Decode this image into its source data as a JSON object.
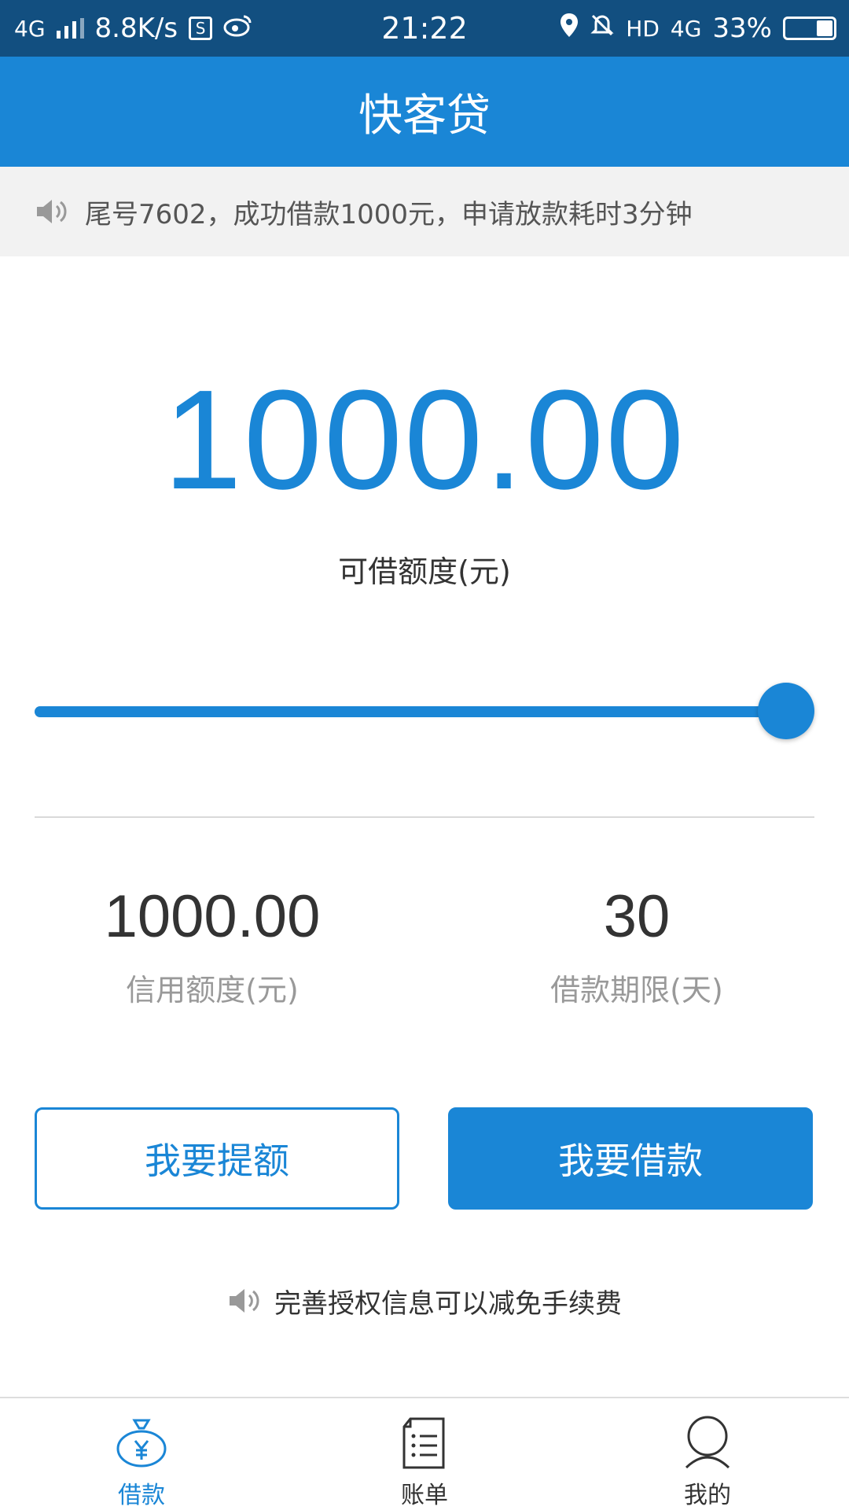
{
  "status_bar": {
    "network": "4G",
    "speed": "8.8K/s",
    "time": "21:22",
    "hd": "HD",
    "network2": "4G",
    "battery": "33%"
  },
  "header": {
    "title": "快客贷"
  },
  "notice": {
    "text": "尾号7602，成功借款1000元，申请放款耗时3分钟"
  },
  "loan": {
    "available_amount": "1000.00",
    "available_label": "可借额度(元)",
    "slider_fraction": 1.0
  },
  "stats": {
    "credit_value": "1000.00",
    "credit_label": "信用额度(元)",
    "term_value": "30",
    "term_label": "借款期限(天)"
  },
  "buttons": {
    "increase_label": "我要提额",
    "borrow_label": "我要借款"
  },
  "tip": {
    "text": "完善授权信息可以减免手续费"
  },
  "nav": {
    "items": [
      {
        "label": "借款",
        "icon": "money-bag-icon",
        "active": true
      },
      {
        "label": "账单",
        "icon": "bill-icon",
        "active": false
      },
      {
        "label": "我的",
        "icon": "user-icon",
        "active": false
      }
    ]
  },
  "colors": {
    "primary": "#1a86d6",
    "status_bar": "#124f80",
    "notice_bg": "#f2f2f2"
  }
}
